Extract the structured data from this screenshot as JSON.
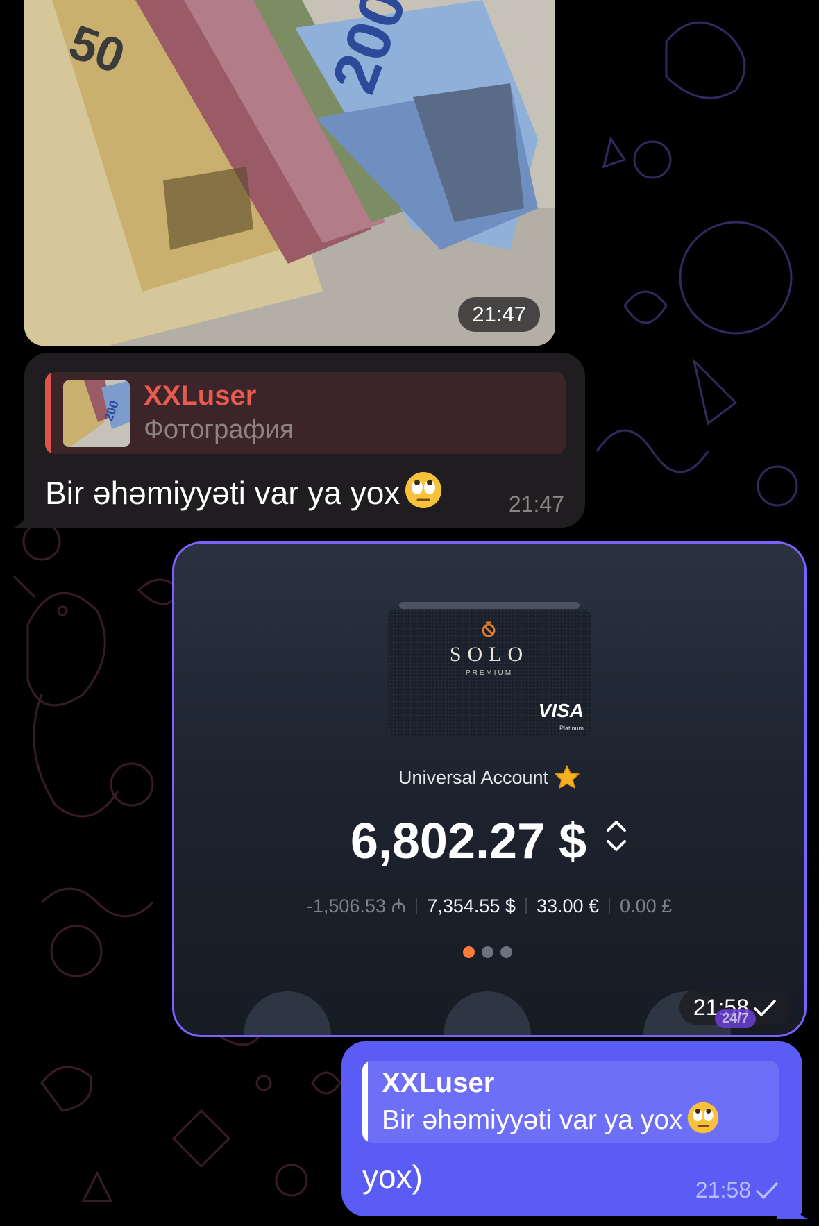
{
  "messages": {
    "photo": {
      "time": "21:47"
    },
    "reply": {
      "quote_author": "XXLuser",
      "quote_type": "Фотография",
      "text": "Bir əhəmiyyəti var ya yox",
      "emoji": "face-with-rolling-eyes",
      "time": "21:47"
    },
    "screenshot": {
      "card": {
        "brand": "SOLO",
        "tier": "PREMIUM",
        "network": "VISA",
        "network_tier": "Platinum"
      },
      "account_name": "Universal Account",
      "balance": "6,802.27 $",
      "sub_balances": [
        "-1,506.53 ₼",
        "7,354.55 $",
        "33.00 €",
        "0.00 £"
      ],
      "page_dots": 3,
      "active_dot": 0,
      "badge": "24/7",
      "time": "21:58"
    },
    "outgoing": {
      "quote_author": "XXLuser",
      "quote_text": "Bir əhəmiyyəti var ya yox",
      "text": "yox)",
      "time": "21:58"
    }
  },
  "colors": {
    "background": "#000000",
    "incoming_bubble": "#1f1d20",
    "outgoing_bubble": "#5b5bf5",
    "quote_accent": "#e0534a",
    "author_incoming": "#ea5a4f",
    "screenshot_border": "#7b62ff",
    "active_dot": "#ff7a3c"
  }
}
